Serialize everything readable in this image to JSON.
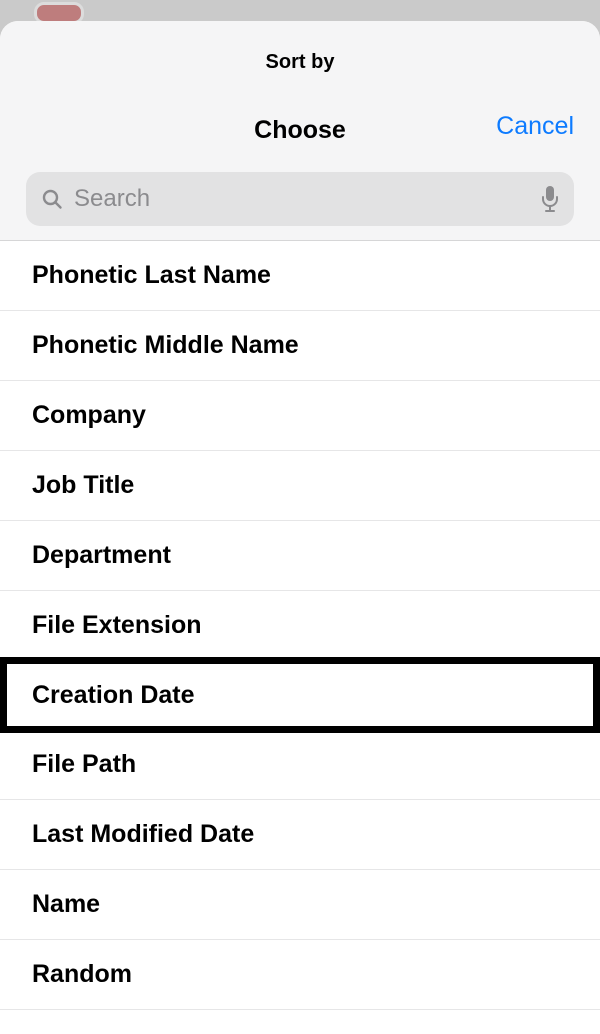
{
  "header": {
    "title": "Sort by",
    "choose_label": "Choose",
    "cancel_label": "Cancel"
  },
  "search": {
    "placeholder": "Search",
    "value": ""
  },
  "options": [
    {
      "label": "Phonetic Last Name",
      "highlighted": false
    },
    {
      "label": "Phonetic Middle Name",
      "highlighted": false
    },
    {
      "label": "Company",
      "highlighted": false
    },
    {
      "label": "Job Title",
      "highlighted": false
    },
    {
      "label": "Department",
      "highlighted": false
    },
    {
      "label": "File Extension",
      "highlighted": false
    },
    {
      "label": "Creation Date",
      "highlighted": true
    },
    {
      "label": "File Path",
      "highlighted": false
    },
    {
      "label": "Last Modified Date",
      "highlighted": false
    },
    {
      "label": "Name",
      "highlighted": false
    },
    {
      "label": "Random",
      "highlighted": false
    }
  ],
  "colors": {
    "accent": "#0d7bff",
    "search_bg": "#e2e2e3",
    "placeholder": "#8b8b8e",
    "divider": "#e6e6e7"
  }
}
